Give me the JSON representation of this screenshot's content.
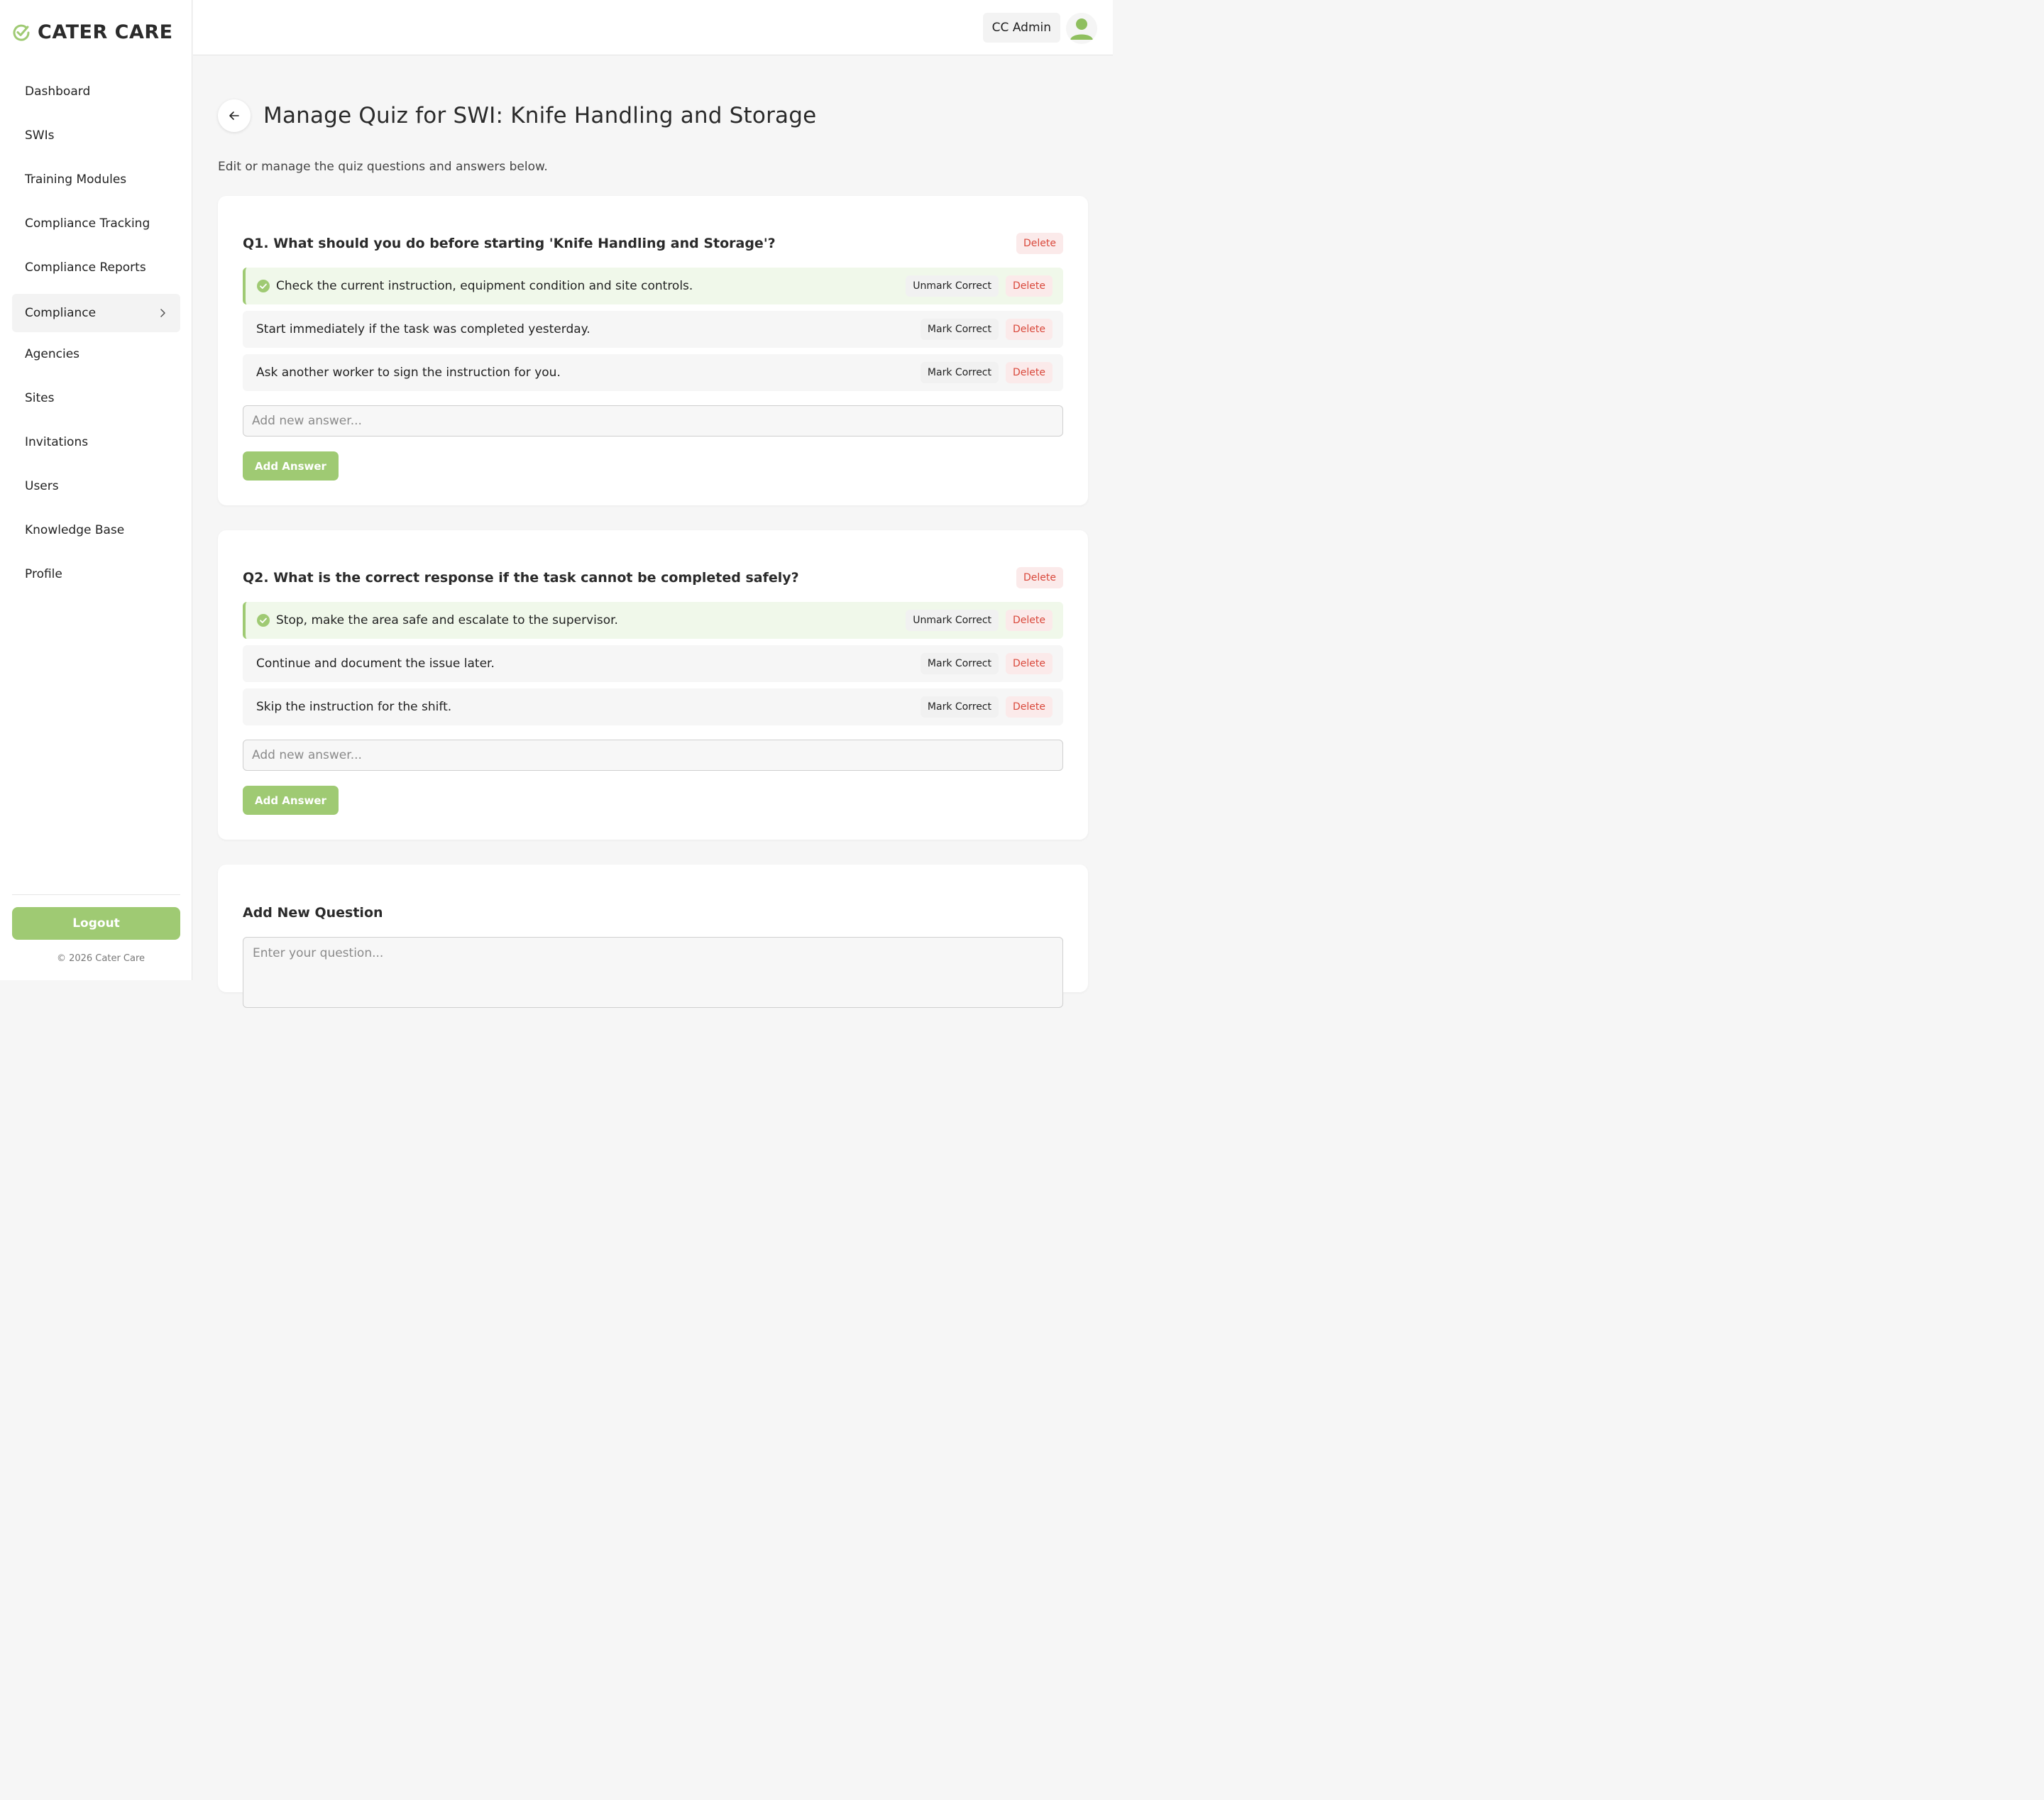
{
  "brand": {
    "name": "CATER CARE"
  },
  "sidebar": {
    "items": [
      {
        "label": "Dashboard"
      },
      {
        "label": "SWIs"
      },
      {
        "label": "Training Modules"
      },
      {
        "label": "Compliance Tracking"
      },
      {
        "label": "Compliance Reports"
      },
      {
        "label": "Compliance"
      },
      {
        "label": "Agencies"
      },
      {
        "label": "Sites"
      },
      {
        "label": "Invitations"
      },
      {
        "label": "Users"
      },
      {
        "label": "Knowledge Base"
      },
      {
        "label": "Profile"
      }
    ],
    "logout_label": "Logout",
    "copyright": "© 2026 Cater Care"
  },
  "header": {
    "user_name": "CC Admin"
  },
  "page": {
    "title": "Manage Quiz for SWI: Knife Handling and Storage",
    "subtitle": "Edit or manage the quiz questions and answers below."
  },
  "labels": {
    "delete": "Delete",
    "mark_correct": "Mark Correct",
    "unmark_correct": "Unmark Correct",
    "add_answer": "Add Answer",
    "new_answer_placeholder": "Add new answer...",
    "add_new_question": "Add New Question",
    "new_question_placeholder": "Enter your question..."
  },
  "questions": [
    {
      "text": "Q1. What should you do before starting 'Knife Handling and Storage'?",
      "answers": [
        {
          "text": "Check the current instruction, equipment condition and site controls.",
          "correct": true
        },
        {
          "text": "Start immediately if the task was completed yesterday.",
          "correct": false
        },
        {
          "text": "Ask another worker to sign the instruction for you.",
          "correct": false
        }
      ]
    },
    {
      "text": "Q2. What is the correct response if the task cannot be completed safely?",
      "answers": [
        {
          "text": "Stop, make the area safe and escalate to the supervisor.",
          "correct": true
        },
        {
          "text": "Continue and document the issue later.",
          "correct": false
        },
        {
          "text": "Skip the instruction for the shift.",
          "correct": false
        }
      ]
    }
  ],
  "colors": {
    "accent": "#9fca73",
    "danger": "#d9483b"
  }
}
